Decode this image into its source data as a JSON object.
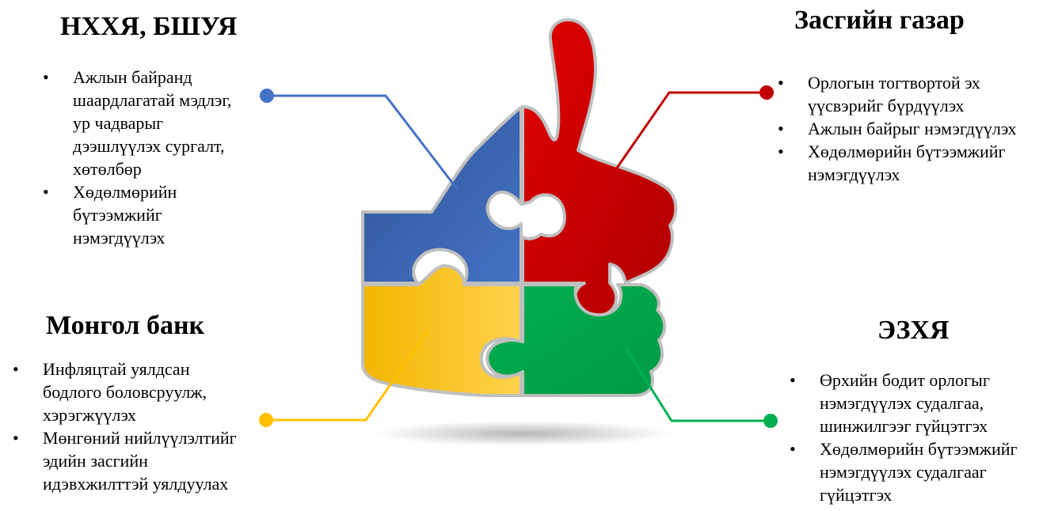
{
  "colors": {
    "blue": "#4472C4",
    "red": "#C00000",
    "yellow": "#FFC000",
    "green": "#00B050"
  },
  "sections": [
    {
      "heading": "НХХЯ, БШУЯ",
      "color": "#4472C4",
      "items": [
        "Ажлын байранд шаардлагатай мэдлэг, ур чадварыг дээшлүүлэх сургалт, хөтөлбөр",
        "Хөдөлмөрийн бүтээмжийг нэмэгдүүлэх"
      ]
    },
    {
      "heading": "Засгийн газар",
      "color": "#C00000",
      "items": [
        "Орлогын тогтвортой эх үүсвэрийг бүрдүүлэх",
        "Ажлын байрыг нэмэгдүүлэх",
        "Хөдөлмөрийн бүтээмжийг нэмэгдүүлэх"
      ]
    },
    {
      "heading": "Монгол банк",
      "color": "#FFC000",
      "items": [
        "Инфляцтай уялдсан бодлого боловсруулж, хэрэгжүүлэх",
        "Мөнгөний нийлүүлэлтийг эдийн засгийн идэвхжилттэй уялдуулах"
      ]
    },
    {
      "heading": "ЭЗХЯ",
      "color": "#00B050",
      "items": [
        "Өрхийн бодит орлогыг нэмэгдүүлэх судалгаа, шинжилгээг гүйцэтгэх",
        "Хөдөлмөрийн бүтээмжийг нэмэгдүүлэх судалгааг гүйцэтгэх"
      ]
    }
  ]
}
